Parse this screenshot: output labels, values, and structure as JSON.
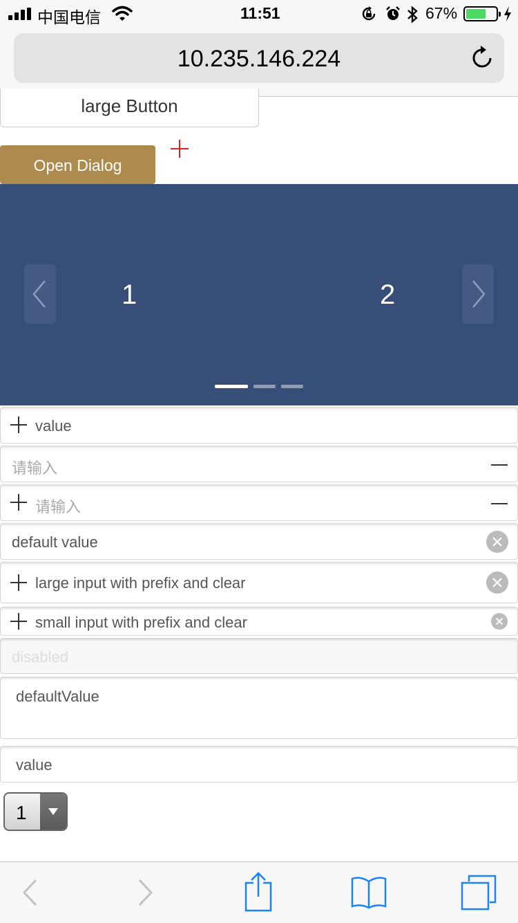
{
  "status_bar": {
    "carrier": "中国电信",
    "time": "11:51",
    "battery": "67%",
    "battery_level": 0.67
  },
  "browser": {
    "url": "10.235.146.224"
  },
  "buttons": {
    "large_label": "large Button",
    "open_dialog_label": "Open Dialog"
  },
  "carousel": {
    "slides": [
      "1",
      "2"
    ],
    "active_index": 0,
    "dot_count": 3
  },
  "inputs": [
    {
      "value": "value",
      "placeholder": "",
      "prefix": true,
      "minus": false,
      "clear": false,
      "disabled": false
    },
    {
      "value": "",
      "placeholder": "请输入",
      "prefix": false,
      "minus": true,
      "clear": false,
      "disabled": false
    },
    {
      "value": "",
      "placeholder": "请输入",
      "prefix": true,
      "minus": true,
      "clear": false,
      "disabled": false
    },
    {
      "value": "default value",
      "placeholder": "",
      "prefix": false,
      "minus": false,
      "clear": true,
      "disabled": false
    },
    {
      "value": "large input with prefix and clear",
      "placeholder": "",
      "prefix": true,
      "minus": false,
      "clear": true,
      "disabled": false
    },
    {
      "value": "small input with prefix and clear",
      "placeholder": "",
      "prefix": true,
      "minus": false,
      "clear": true,
      "disabled": false
    },
    {
      "value": "disabled",
      "placeholder": "",
      "prefix": false,
      "minus": false,
      "clear": false,
      "disabled": true
    }
  ],
  "textarea": {
    "value": "defaultValue"
  },
  "plain_input": {
    "value": "value"
  },
  "select": {
    "selected": "1"
  },
  "colors": {
    "carousel_bg": "#374e79",
    "dialog_button": "#ad8a4d",
    "ios_blue": "#1a82fb",
    "red_icon": "#e02020"
  }
}
